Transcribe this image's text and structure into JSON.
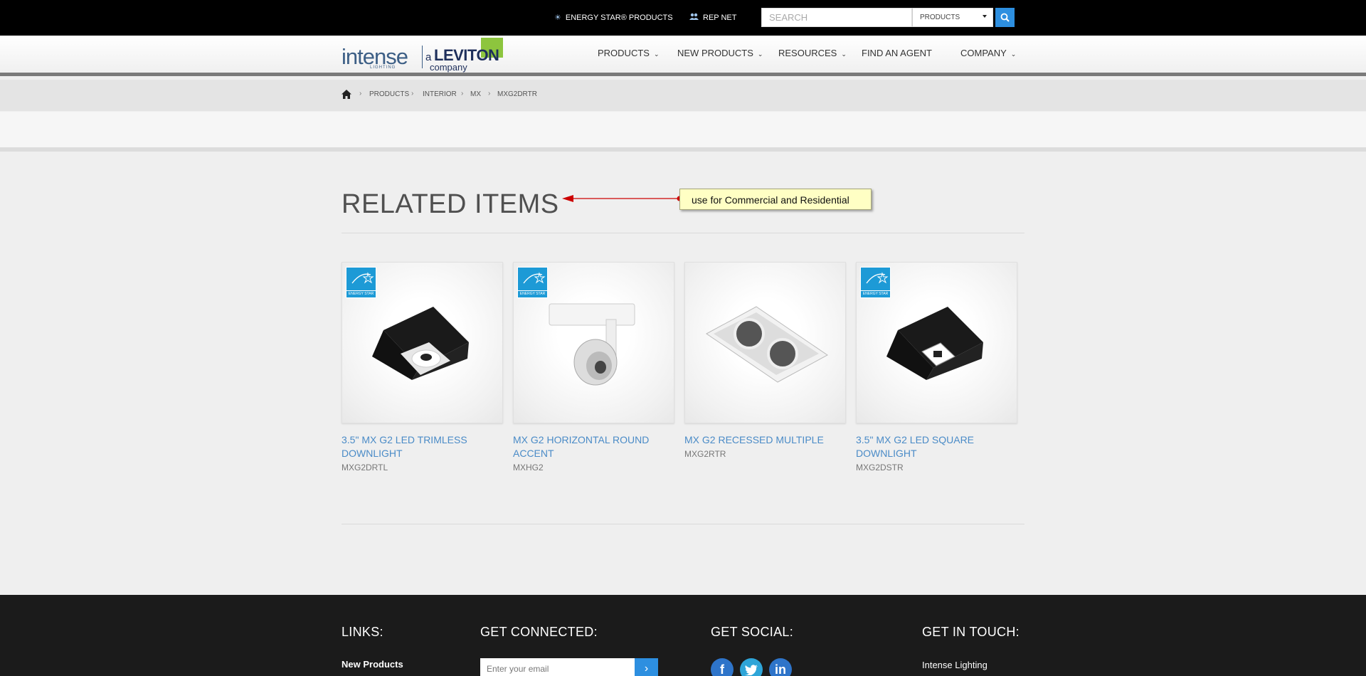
{
  "topbar": {
    "energy_star_label": "ENERGY STAR® PRODUCTS",
    "rep_net_label": "REP NET",
    "search_placeholder": "SEARCH",
    "category_selected": "PRODUCTS"
  },
  "header": {
    "logo": {
      "brand": "intense",
      "sub": "LIGHTING",
      "a": "a",
      "parent": "LEVITON",
      "company": "company"
    },
    "nav": [
      "PRODUCTS",
      "NEW PRODUCTS",
      "RESOURCES",
      "FIND AN AGENT",
      "COMPANY"
    ]
  },
  "breadcrumb": [
    "PRODUCTS",
    "INTERIOR",
    "MX",
    "MXG2DRTR"
  ],
  "related": {
    "title": "RELATED ITEMS",
    "annotation": "use for Commercial and Residential",
    "items": [
      {
        "name": "3.5\" MX G2 LED TRIMLESS DOWNLIGHT",
        "sku": "MXG2DRTL",
        "energy_star": true,
        "badge_label": "ENERGY STAR"
      },
      {
        "name": "MX G2 HORIZONTAL ROUND ACCENT",
        "sku": "MXHG2",
        "energy_star": true,
        "badge_label": "ENERGY STAR"
      },
      {
        "name": "MX G2 RECESSED MULTIPLE",
        "sku": "MXG2RTR",
        "energy_star": false
      },
      {
        "name": "3.5\" MX G2 LED SQUARE DOWNLIGHT",
        "sku": "MXG2DSTR",
        "energy_star": true,
        "badge_label": "ENERGY STAR"
      }
    ]
  },
  "footer": {
    "links_heading": "LINKS:",
    "links": [
      "New Products"
    ],
    "connected_heading": "GET CONNECTED:",
    "email_placeholder": "Enter your email",
    "social_heading": "GET SOCIAL:",
    "social": [
      "f",
      "t",
      "in"
    ],
    "touch_heading": "GET IN TOUCH:",
    "contact_name": "Intense Lighting"
  },
  "colors": {
    "accent": "#2d8fe0",
    "link": "#4a8bc7",
    "energy_star": "#1d9ad6",
    "leviton_green": "#8dc53e"
  }
}
